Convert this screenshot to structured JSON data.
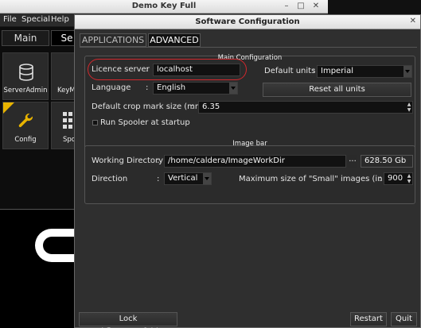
{
  "bg_window": {
    "title": "Demo Key Full",
    "menu": [
      "File",
      "Special",
      "Help"
    ],
    "tabs": [
      "Main",
      "Se"
    ],
    "tiles": [
      "ServerAdmin",
      "KeyM",
      "Config",
      "Spo"
    ]
  },
  "dialog": {
    "title": "Software Configuration",
    "tabs": [
      "APPLICATIONS",
      "ADVANCED"
    ],
    "main_config": {
      "title": "Main Configuration",
      "licence_server_label": "Licence server",
      "licence_server_value": "localhost",
      "default_units_label": "Default units",
      "default_units_value": "Imperial",
      "language_label": "Language",
      "language_value": "English",
      "reset_units_label": "Reset all units",
      "crop_mark_label": "Default crop mark size (mm)",
      "crop_mark_value": "6.35",
      "run_spooler_label": "Run Spooler at startup",
      "run_spooler_checked": false
    },
    "image_bar": {
      "title": "Image bar",
      "working_dir_label": "Working Directory",
      "working_dir_value": "/home/caldera/ImageWorkDir",
      "browse_label": "...",
      "disk_free": "628.50 Gb",
      "direction_label": "Direction",
      "direction_value": "Vertical",
      "max_size_label": "Maximum size of \"Small\" images (in Mb)",
      "max_size_value": "900"
    },
    "footer": {
      "lock_label": "Lock Workflows/Hotfolders",
      "restart_label": "Restart",
      "quit_label": "Quit"
    }
  },
  "colors": {
    "highlight": "#d3282d",
    "dialog_bg": "#2f2f2f",
    "field_bg": "#111111",
    "config_corner": "#e8b400"
  }
}
